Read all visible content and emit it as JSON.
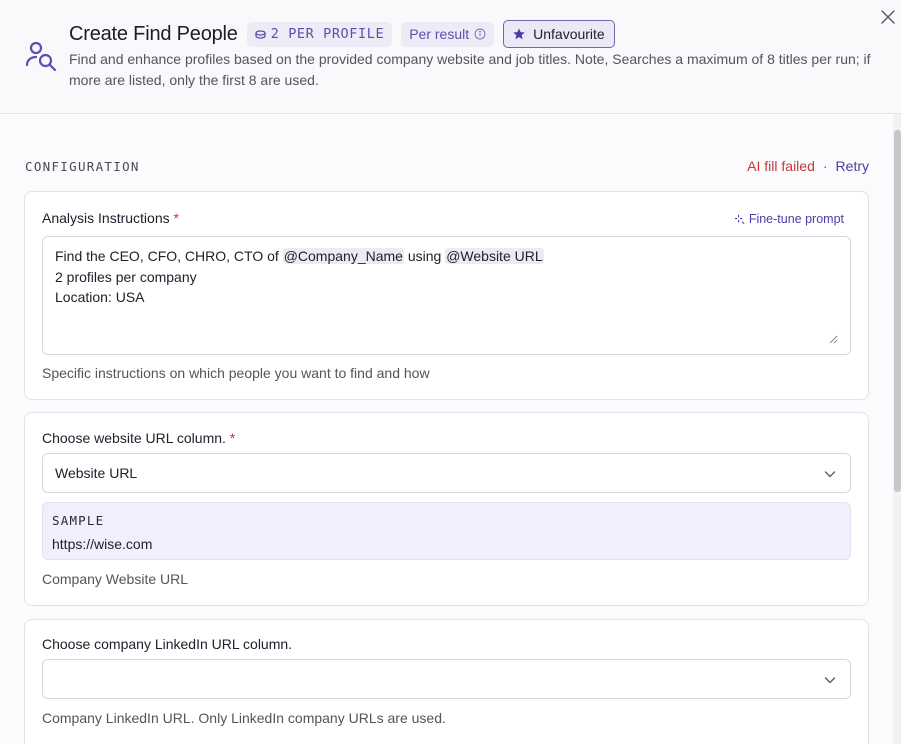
{
  "header": {
    "title": "Create Find People",
    "badge_cost": "2 PER PROFILE",
    "badge_unit": "Per result",
    "favourite_label": "Unfavourite",
    "description": "Find and enhance profiles based on the provided company website and job titles. Note, Searches a maximum of 8 titles per run; if more are listed, only the first 8 are used."
  },
  "section": {
    "title": "CONFIGURATION",
    "status_failed": "AI fill failed",
    "status_separator": "·",
    "retry_label": "Retry"
  },
  "analysis": {
    "label": "Analysis Instructions",
    "required_mark": "*",
    "finetune_label": "Fine-tune prompt",
    "line1_prefix": "Find the CEO, CFO, CHRO, CTO of ",
    "mention1": "@Company_Name",
    "line1_mid": " using ",
    "mention2": "@Website URL",
    "line2": "2 profiles per company",
    "line3": "Location: USA",
    "hint": "Specific instructions on which people you want to find and how"
  },
  "website": {
    "label": "Choose website URL column.",
    "required_mark": "*",
    "selected": "Website URL",
    "sample_label": "SAMPLE",
    "sample_value": "https://wise.com",
    "hint": "Company Website URL"
  },
  "linkedin": {
    "label": "Choose company LinkedIn URL column.",
    "selected": "",
    "hint": "Company LinkedIn URL. Only LinkedIn company URLs are used."
  },
  "colors": {
    "accent": "#5b4fb0",
    "error": "#c23b3b",
    "required": "#c9364a"
  },
  "icons": [
    "find-people-icon",
    "coin-icon",
    "info-icon",
    "star-icon",
    "close-icon",
    "sparkle-icon",
    "chevron-down-icon",
    "resize-handle-icon"
  ]
}
